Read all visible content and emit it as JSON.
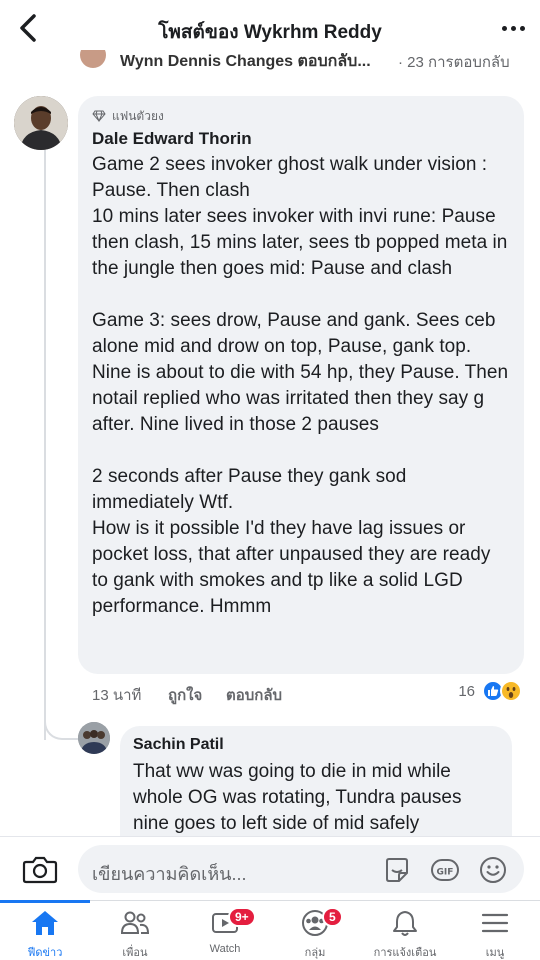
{
  "header": {
    "title": "โพสต์ของ Wykrhm Reddy",
    "back_icon": "chevron-left-icon",
    "more_icon": "more-dots-icon"
  },
  "previous_reply": {
    "text": "Wynn Dennis Changes ตอบกลับ...",
    "count": "· 23 การตอบกลับ"
  },
  "comment": {
    "badge": "แฟนตัวยง",
    "author": "Dale Edward Thorin",
    "text": "Game 2 sees invoker ghost walk under vision : Pause. Then clash\n10 mins later sees invoker with invi rune: Pause then clash, 15 mins later, sees tb popped meta in the jungle then goes mid: Pause and clash\n\nGame 3: sees drow, Pause and gank. Sees ceb alone mid and drow on top, Pause, gank top. Nine is about to die with 54 hp, they Pause. Then notail replied who was irritated then they say g after. Nine lived in those 2 pauses\n\n2 seconds after Pause they gank sod immediately Wtf.\nHow is it possible I'd they have lag issues or pocket loss, that after unpaused they are ready to gank with smokes and tp like a solid LGD performance. Hmmm",
    "time": "13 นาที",
    "like_label": "ถูกใจ",
    "reply_label": "ตอบกลับ",
    "reaction_count": "16"
  },
  "reply": {
    "author": "Sachin Patil",
    "text": "That ww was going to die in mid while whole OG was rotating, Tundra pauses nine goes to left side of mid safely"
  },
  "composer": {
    "placeholder": "เขียนความคิดเห็น..."
  },
  "nav": {
    "items": [
      {
        "label": "ฟีดข่าว",
        "icon": "home-icon"
      },
      {
        "label": "เพื่อน",
        "icon": "friends-icon"
      },
      {
        "label": "Watch",
        "icon": "watch-icon",
        "badge": "9+"
      },
      {
        "label": "กลุ่ม",
        "icon": "groups-icon",
        "badge": "5"
      },
      {
        "label": "การแจ้งเตือน",
        "icon": "bell-icon"
      },
      {
        "label": "เมนู",
        "icon": "menu-icon"
      }
    ]
  },
  "colors": {
    "accent": "#1877f2",
    "bubble": "#f0f2f5",
    "badge": "#e41e3f"
  }
}
